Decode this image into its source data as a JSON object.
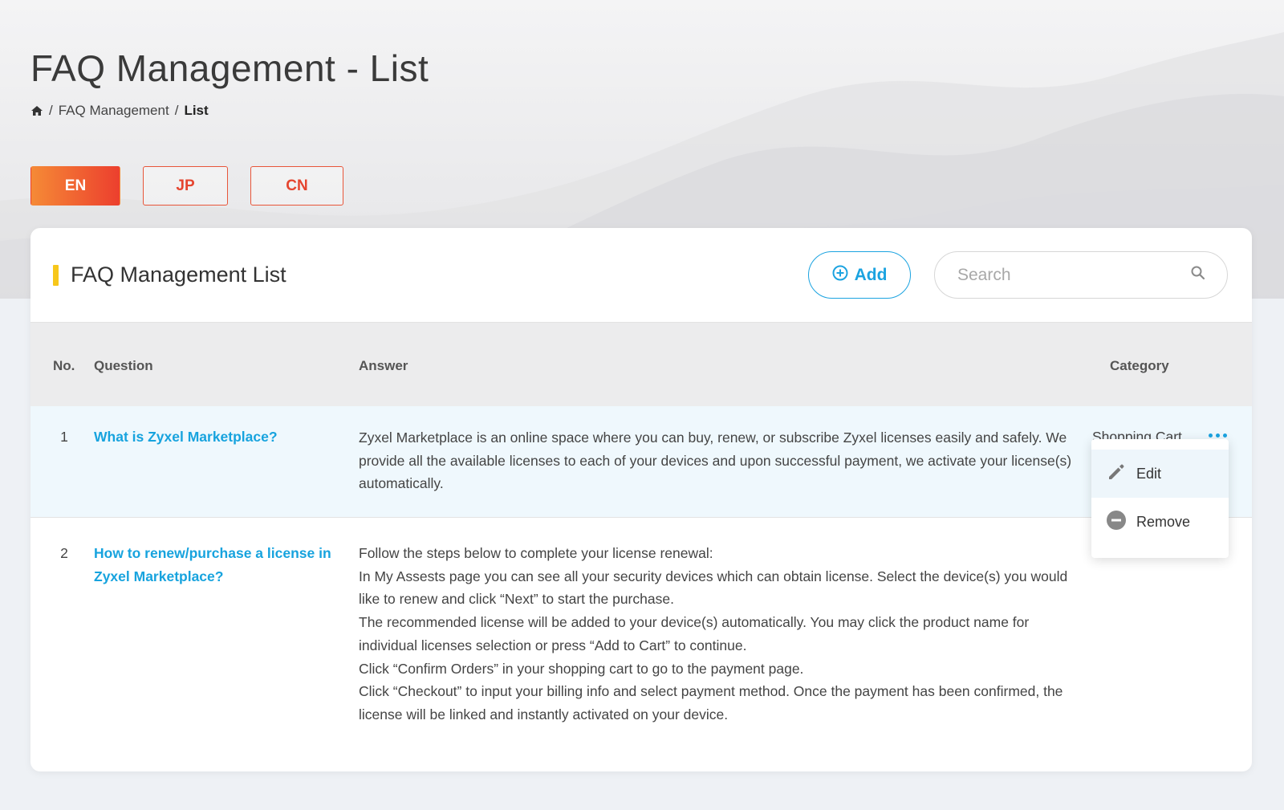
{
  "page": {
    "title": "FAQ Management - List",
    "breadcrumb": {
      "section": "FAQ Management",
      "current": "List"
    }
  },
  "languages": [
    {
      "label": "EN",
      "active": true
    },
    {
      "label": "JP",
      "active": false
    },
    {
      "label": "CN",
      "active": false
    }
  ],
  "card": {
    "title": "FAQ Management List",
    "add_label": "Add",
    "search_placeholder": "Search"
  },
  "table": {
    "headers": {
      "no": "No.",
      "question": "Question",
      "answer": "Answer",
      "category": "Category"
    },
    "rows": [
      {
        "no": "1",
        "question": "What is Zyxel Marketplace?",
        "answer": "Zyxel Marketplace is an online space where you can buy, renew, or subscribe Zyxel licenses easily and safely. We provide all the available licenses to each of your devices and upon successful payment, we activate your license(s) automatically.",
        "category": "Shopping Cart"
      },
      {
        "no": "2",
        "question": "How to renew/purchase a license in Zyxel Marketplace?",
        "answer": "Follow the steps below to complete your license renewal:\nIn My Assests page you can see all your security devices which can obtain license. Select the device(s) you would like to renew and click “Next” to start the purchase.\nThe recommended license will be added to your device(s) automatically. You may click the product name for individual licenses selection or press “Add to Cart” to continue.\nClick “Confirm Orders” in your shopping cart to go to the payment page.\nClick “Checkout” to input your billing info and select payment method. Once the payment has been confirmed, the license will be linked and instantly activated on your device.",
        "category": ""
      }
    ]
  },
  "menu": {
    "edit_label": "Edit",
    "remove_label": "Remove"
  },
  "colors": {
    "accent_blue": "#1ba3e0",
    "accent_orange": "#f58a36",
    "accent_red": "#ec3f2e",
    "title_bar_yellow": "#f7c71b"
  }
}
